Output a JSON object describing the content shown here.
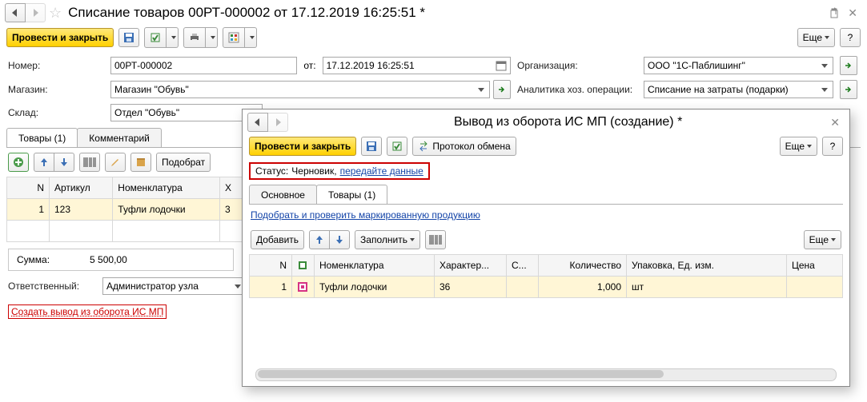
{
  "main": {
    "title": "Списание товаров 00РТ-000002 от 17.12.2019 16:25:51 *",
    "toolbar": {
      "post_close": "Провести и закрыть",
      "more": "Еще",
      "help": "?"
    },
    "form": {
      "number_label": "Номер:",
      "number": "00РТ-000002",
      "ot": "от:",
      "date": "17.12.2019 16:25:51",
      "org_label": "Организация:",
      "org": "ООО \"1С-Паблишинг\"",
      "store_label": "Магазин:",
      "store": "Магазин \"Обувь\"",
      "analytics_label": "Аналитика хоз. операции:",
      "analytics": "Списание на затраты (подарки)",
      "warehouse_label": "Склад:",
      "warehouse": "Отдел \"Обувь\""
    },
    "tabs": {
      "goods": "Товары (1)",
      "comment": "Комментарий"
    },
    "tbltoolbar": {
      "pick": "Подобрат"
    },
    "table": {
      "headers": {
        "n": "N",
        "sku": "Артикул",
        "nomen": "Номенклатура",
        "char": "Х"
      },
      "row": {
        "n": "1",
        "sku": "123",
        "nomen": "Туфли лодочки",
        "char": "3"
      }
    },
    "sum": {
      "label": "Сумма:",
      "value": "5 500,00"
    },
    "responsible_label": "Ответственный:",
    "responsible": "Администратор узла",
    "action_link": "Создать вывод из оборота ИС МП"
  },
  "overlay": {
    "title": "Вывод из оборота ИС МП (создание) *",
    "toolbar": {
      "post_close": "Провести и закрыть",
      "protocol": "Протокол обмена",
      "more": "Еще",
      "help": "?"
    },
    "status": {
      "label": "Статус:",
      "value": "Черновик,",
      "link": "передайте данные"
    },
    "tabs": {
      "main": "Основное",
      "goods": "Товары (1)"
    },
    "link_pick": "Подобрать и проверить маркированную продукцию",
    "tbltoolbar": {
      "add": "Добавить",
      "fill": "Заполнить",
      "more": "Еще"
    },
    "table": {
      "headers": {
        "n": "N",
        "mark": "",
        "nomen": "Номенклатура",
        "char": "Характер...",
        "s": "С...",
        "qty": "Количество",
        "pack": "Упаковка, Ед. изм.",
        "price": "Цена"
      },
      "row": {
        "n": "1",
        "nomen": "Туфли лодочки",
        "char": "36",
        "s": "",
        "qty": "1,000",
        "pack": "шт",
        "price": ""
      }
    }
  },
  "chart_data": null
}
